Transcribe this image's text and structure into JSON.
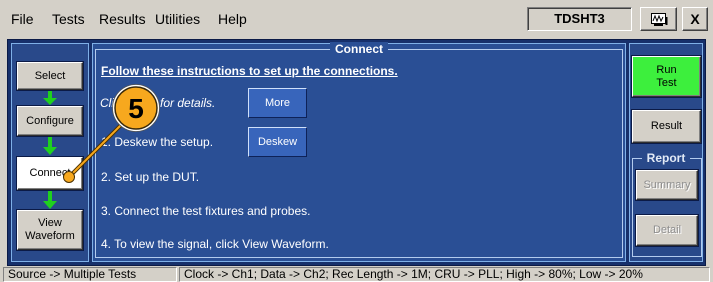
{
  "window": {
    "app_title": "TDSHT3",
    "close_label": "X",
    "scope_button_icon": "scope-view-icon"
  },
  "menu": {
    "items": [
      "File",
      "Tests",
      "Results",
      "Utilities",
      "Help"
    ]
  },
  "workflow": {
    "steps": [
      "Select",
      "Configure",
      "Connect",
      "View Waveform"
    ],
    "active_step_index": 2,
    "arrow_icon": "down-arrow-icon"
  },
  "panel": {
    "title": "Connect",
    "heading": "Follow these instructions to set up the connections.",
    "more_hint": "Click More for details.",
    "more_button": "More",
    "deskew_button": "Deskew",
    "instructions": [
      "1. Deskew the setup.",
      "2. Set up the DUT.",
      "3. Connect the test fixtures and probes.",
      "4. To view the signal, click View Waveform."
    ]
  },
  "actions": {
    "run_test": "Run Test",
    "result": "Result",
    "report": {
      "title": "Report",
      "summary": "Summary",
      "detail": "Detail",
      "enabled": false
    }
  },
  "status_bar": {
    "source": "Source -> Multiple Tests",
    "settings": "Clock -> Ch1; Data -> Ch2; Rec Length -> 1M; CRU -> PLL; High -> 80%; Low -> 20%"
  },
  "callout": {
    "number": "5"
  },
  "colors": {
    "menu_gray": "#d4d0c8",
    "panel_blue": "#2a4f95",
    "run_test_green": "#3def3d",
    "arrow_green": "#1fd01f",
    "callout_orange": "#f7a81e"
  }
}
